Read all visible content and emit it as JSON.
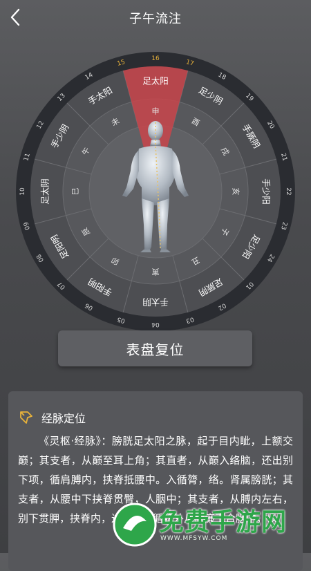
{
  "header": {
    "title": "子午流注"
  },
  "dial": {
    "hours": [
      "15",
      "16",
      "17",
      "18",
      "19",
      "20",
      "21",
      "22",
      "23",
      "24",
      "01",
      "02",
      "03",
      "04",
      "05",
      "06",
      "07",
      "08",
      "09",
      "10",
      "11",
      "12",
      "13",
      "14"
    ],
    "highlight_hours": [
      "15",
      "16",
      "17"
    ],
    "meridians": [
      "足太阳",
      "足少阴",
      "手厥阴",
      "手少阳",
      "足少阳",
      "足厥阴",
      "手太阴",
      "手阳明",
      "足阳明",
      "足太阴",
      "手少阴",
      "手太阳"
    ],
    "branches": [
      "申",
      "酉",
      "戌",
      "亥",
      "子",
      "丑",
      "寅",
      "卯",
      "辰",
      "巳",
      "午",
      "未"
    ],
    "active_meridian": "足太阳"
  },
  "reset_button": {
    "label": "表盘复位"
  },
  "card": {
    "title": "经脉定位",
    "text": "《灵枢·经脉》：膀胱足太阳之脉，起于目内眦，上额交巅；其支者，从巅至耳上角；其直者，从巅入络脑，还出别下项，循肩膊内，挟脊抵腰中。入循膂，络。肾属膀胱；其支者，从腰中下挟脊贯臀，人胭中；其支者，从膊内左右，别下贯胛，挟脊内，过髀枢，循髀外从后廉下合胭中，以"
  },
  "watermark": {
    "text": "免费手游网",
    "sub": "WWW.MFSYW.COM"
  },
  "colors": {
    "highlight": "#c9454b",
    "hour_gold": "#e8b23a",
    "icon_gold": "#e8b23a"
  }
}
